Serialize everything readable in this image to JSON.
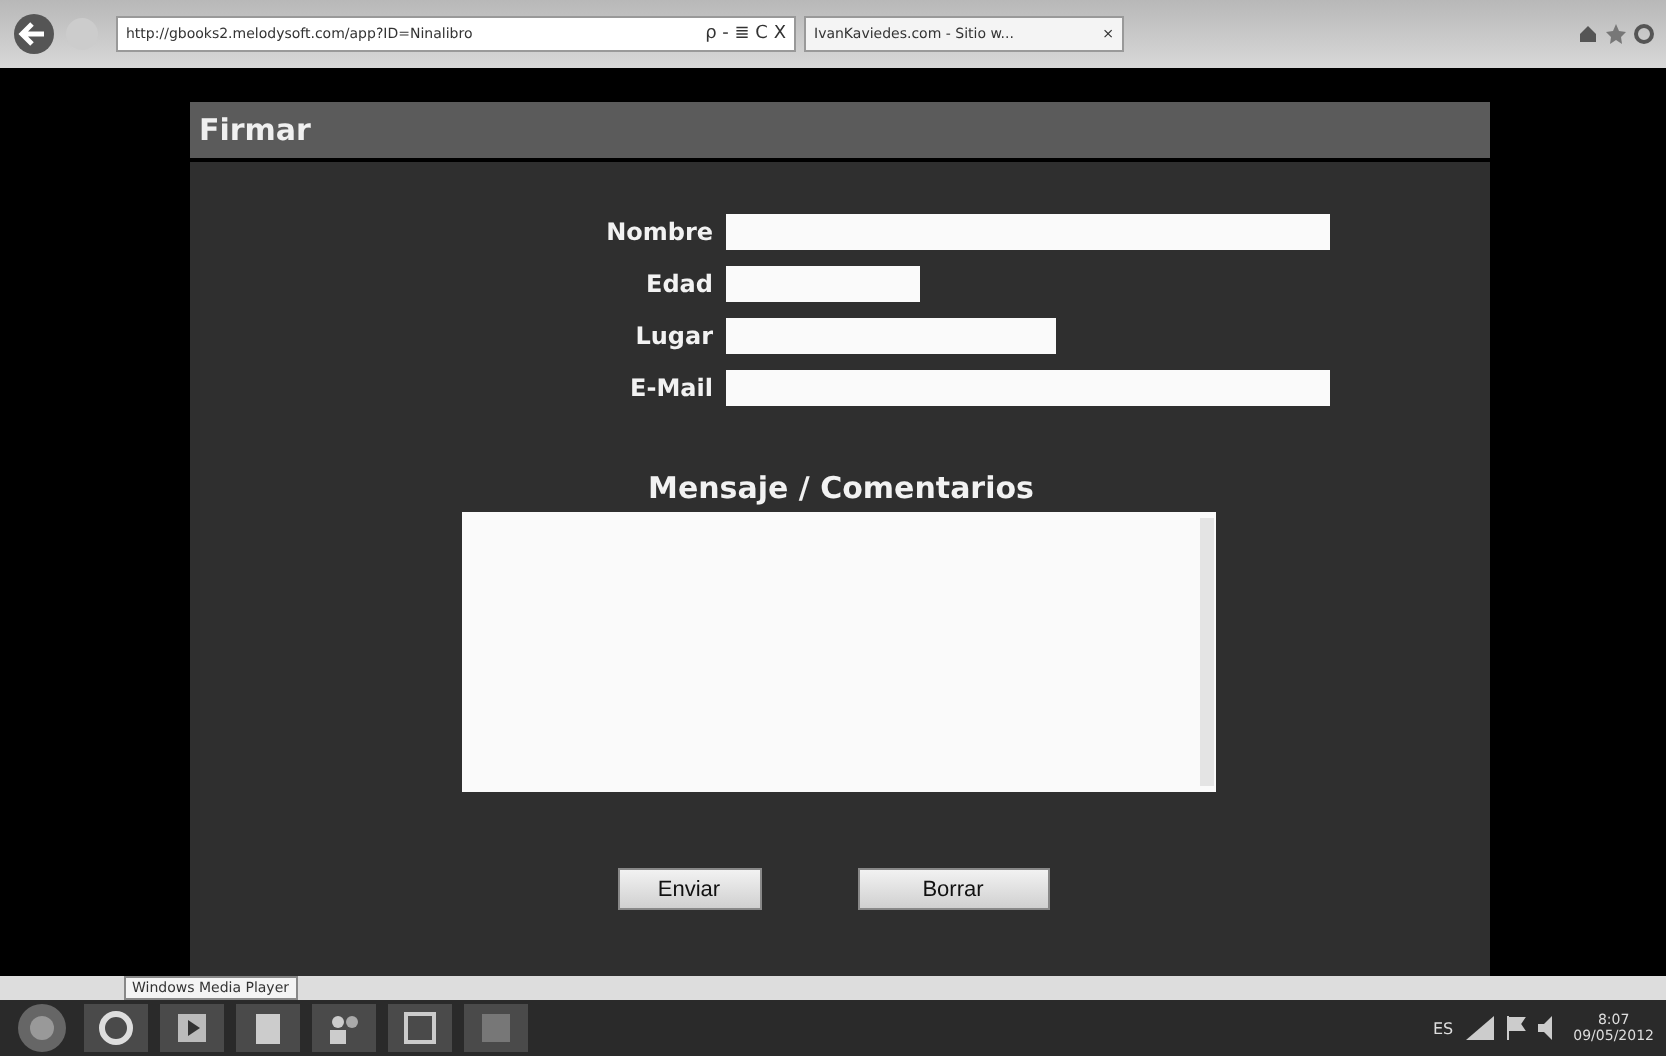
{
  "browser": {
    "address": "http://gbooks2.melodysoft.com/app?ID=Ninalibro",
    "address_controls": "ρ - ≣ C X",
    "tab": "IvanKaviedes.com - Sitio w...",
    "tab_close": "×"
  },
  "page": {
    "title": "Firmar",
    "fields": [
      {
        "label": "Nombre"
      },
      {
        "label": "Edad"
      },
      {
        "label": "Lugar"
      },
      {
        "label": "E-Mail"
      }
    ],
    "message_heading": "Mensaje / Comentarios",
    "buttons": [
      "Enviar",
      "Borrar"
    ]
  },
  "tooltip": "Windows Media Player",
  "taskbar": {
    "language": "ES",
    "time": "8:07",
    "date": "09/05/2012"
  }
}
